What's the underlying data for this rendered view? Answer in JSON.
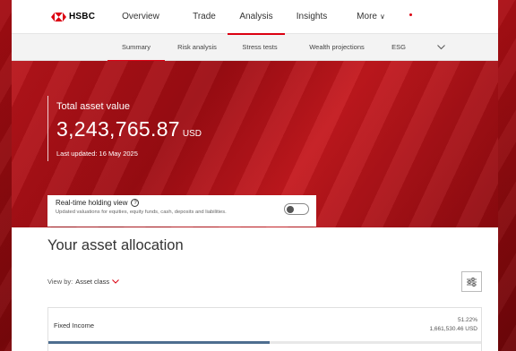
{
  "brand": {
    "name": "HSBC"
  },
  "nav": {
    "items": [
      {
        "label": "Overview"
      },
      {
        "label": "Trade"
      },
      {
        "label": "Analysis"
      },
      {
        "label": "Insights"
      },
      {
        "label": "More"
      }
    ],
    "more_chevron": "∨"
  },
  "subnav": {
    "items": [
      {
        "label": "Summary"
      },
      {
        "label": "Risk analysis"
      },
      {
        "label": "Stress tests"
      },
      {
        "label": "Wealth projections"
      },
      {
        "label": "ESG"
      }
    ],
    "expand_icon": "chevron-down-icon"
  },
  "summary": {
    "title": "Total asset value",
    "value": "3,243,765.87",
    "currency": "USD",
    "updated": "Last updated: 16 May 2025"
  },
  "realtime": {
    "title": "Real-time holding view",
    "help": "?",
    "description": "Updated valuations for equities, equity funds, cash, deposits and liabilities.",
    "enabled": false
  },
  "allocation": {
    "title": "Your asset allocation",
    "view_by_label": "View by:",
    "view_by_value": "Asset class",
    "rows": [
      {
        "label": "Fixed Income",
        "percent": "51.22%",
        "amount": "1,661,530.46 USD",
        "fraction": 0.5122
      }
    ]
  },
  "colors": {
    "brand_red": "#db0011",
    "bar": "#4e6e8f"
  }
}
